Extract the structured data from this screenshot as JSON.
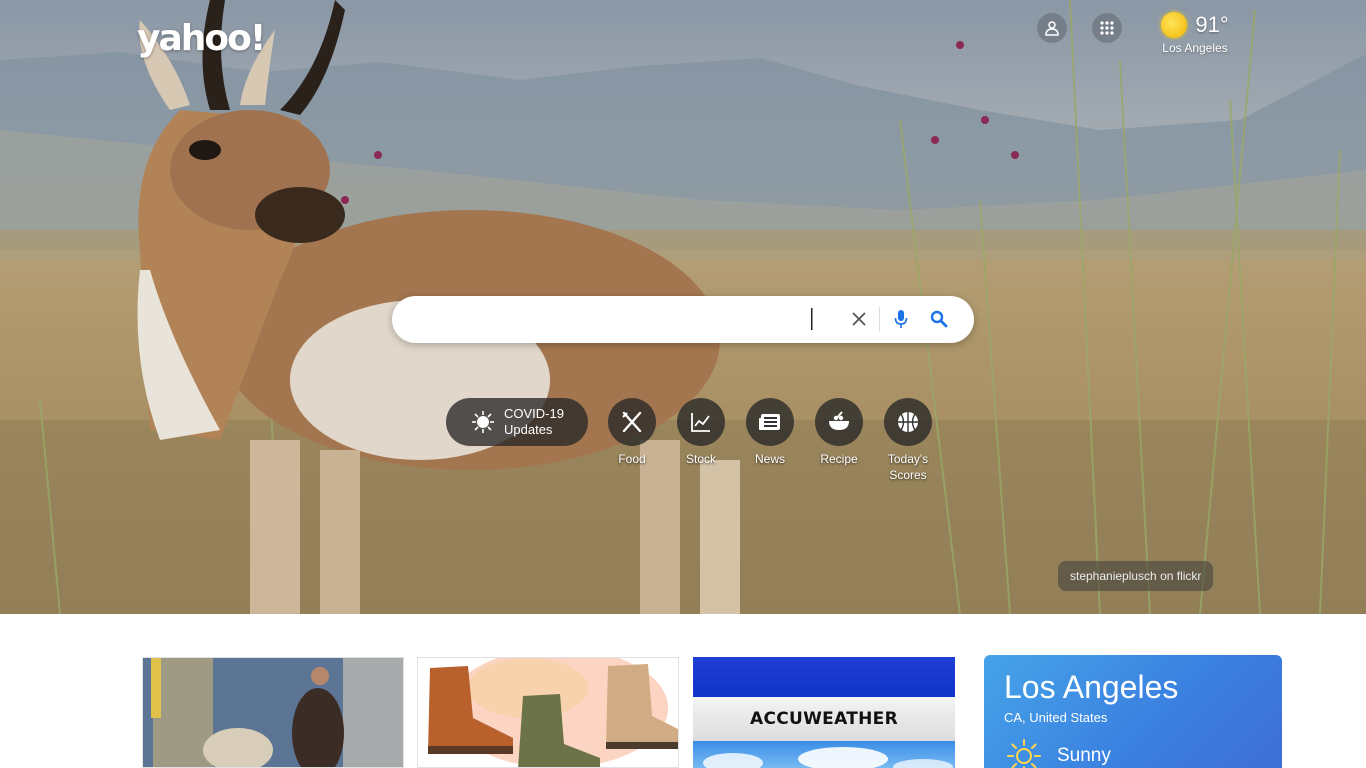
{
  "header": {
    "logo_text": "yahoo!",
    "weather": {
      "temperature": "91°",
      "city": "Los Angeles",
      "icon": "sun-icon"
    }
  },
  "search": {
    "value": "",
    "placeholder": ""
  },
  "quick_links": {
    "covid": {
      "line1": "COVID-19",
      "line2": "Updates",
      "icon": "virus-icon"
    },
    "items": [
      {
        "label": "Food",
        "icon": "fork-knife-icon"
      },
      {
        "label": "Stock",
        "icon": "chart-icon"
      },
      {
        "label": "News",
        "icon": "newspaper-icon"
      },
      {
        "label": "Recipe",
        "icon": "bowl-icon"
      },
      {
        "label_line1": "Today's",
        "label_line2": "Scores",
        "icon": "basketball-icon"
      }
    ]
  },
  "photo_credit": "stephanieplusch on flickr",
  "cards": {
    "accuweather_label": "ACCUWEATHER",
    "weather": {
      "city": "Los Angeles",
      "region": "CA, United States",
      "condition": "Sunny",
      "icon": "sun-icon"
    }
  },
  "colors": {
    "weather_card": "#3a7fe0",
    "search_icon": "#1a73e8",
    "accu_blue": "#1133c8"
  }
}
